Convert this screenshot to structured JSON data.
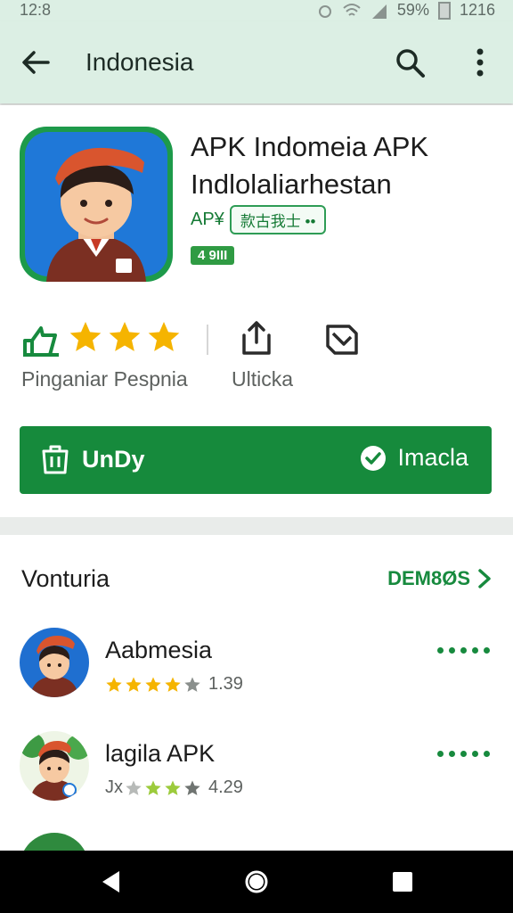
{
  "status_bar": {
    "time": "12:8",
    "battery": "59%",
    "clock": "1216"
  },
  "app_bar": {
    "title": "Indonesia"
  },
  "app": {
    "title_line1": "APK Indomeia APK",
    "title_line2": "Indlolaliarhestan",
    "developer_prefix": "AP¥",
    "developer_chip": "款古我士 ••",
    "badge": "4 9III"
  },
  "actions": {
    "rating_label": "Pinganiar Pespnia",
    "share_label": "Ulticka",
    "stars_filled": 3
  },
  "primary_button": {
    "left_label": "UnDy",
    "right_label": "Imacla"
  },
  "section": {
    "title": "Vonturia",
    "see_more": "DEM8ØS",
    "items": [
      {
        "name": "Aabmesia",
        "rating": "1.39",
        "stars": 4
      },
      {
        "name": "lagila APK",
        "rating": "4.29",
        "stars": 3,
        "prefix": "Jx"
      }
    ]
  },
  "colors": {
    "accent": "#168a3c",
    "app_bar": "#dcefe4",
    "star": "#f5b400"
  }
}
